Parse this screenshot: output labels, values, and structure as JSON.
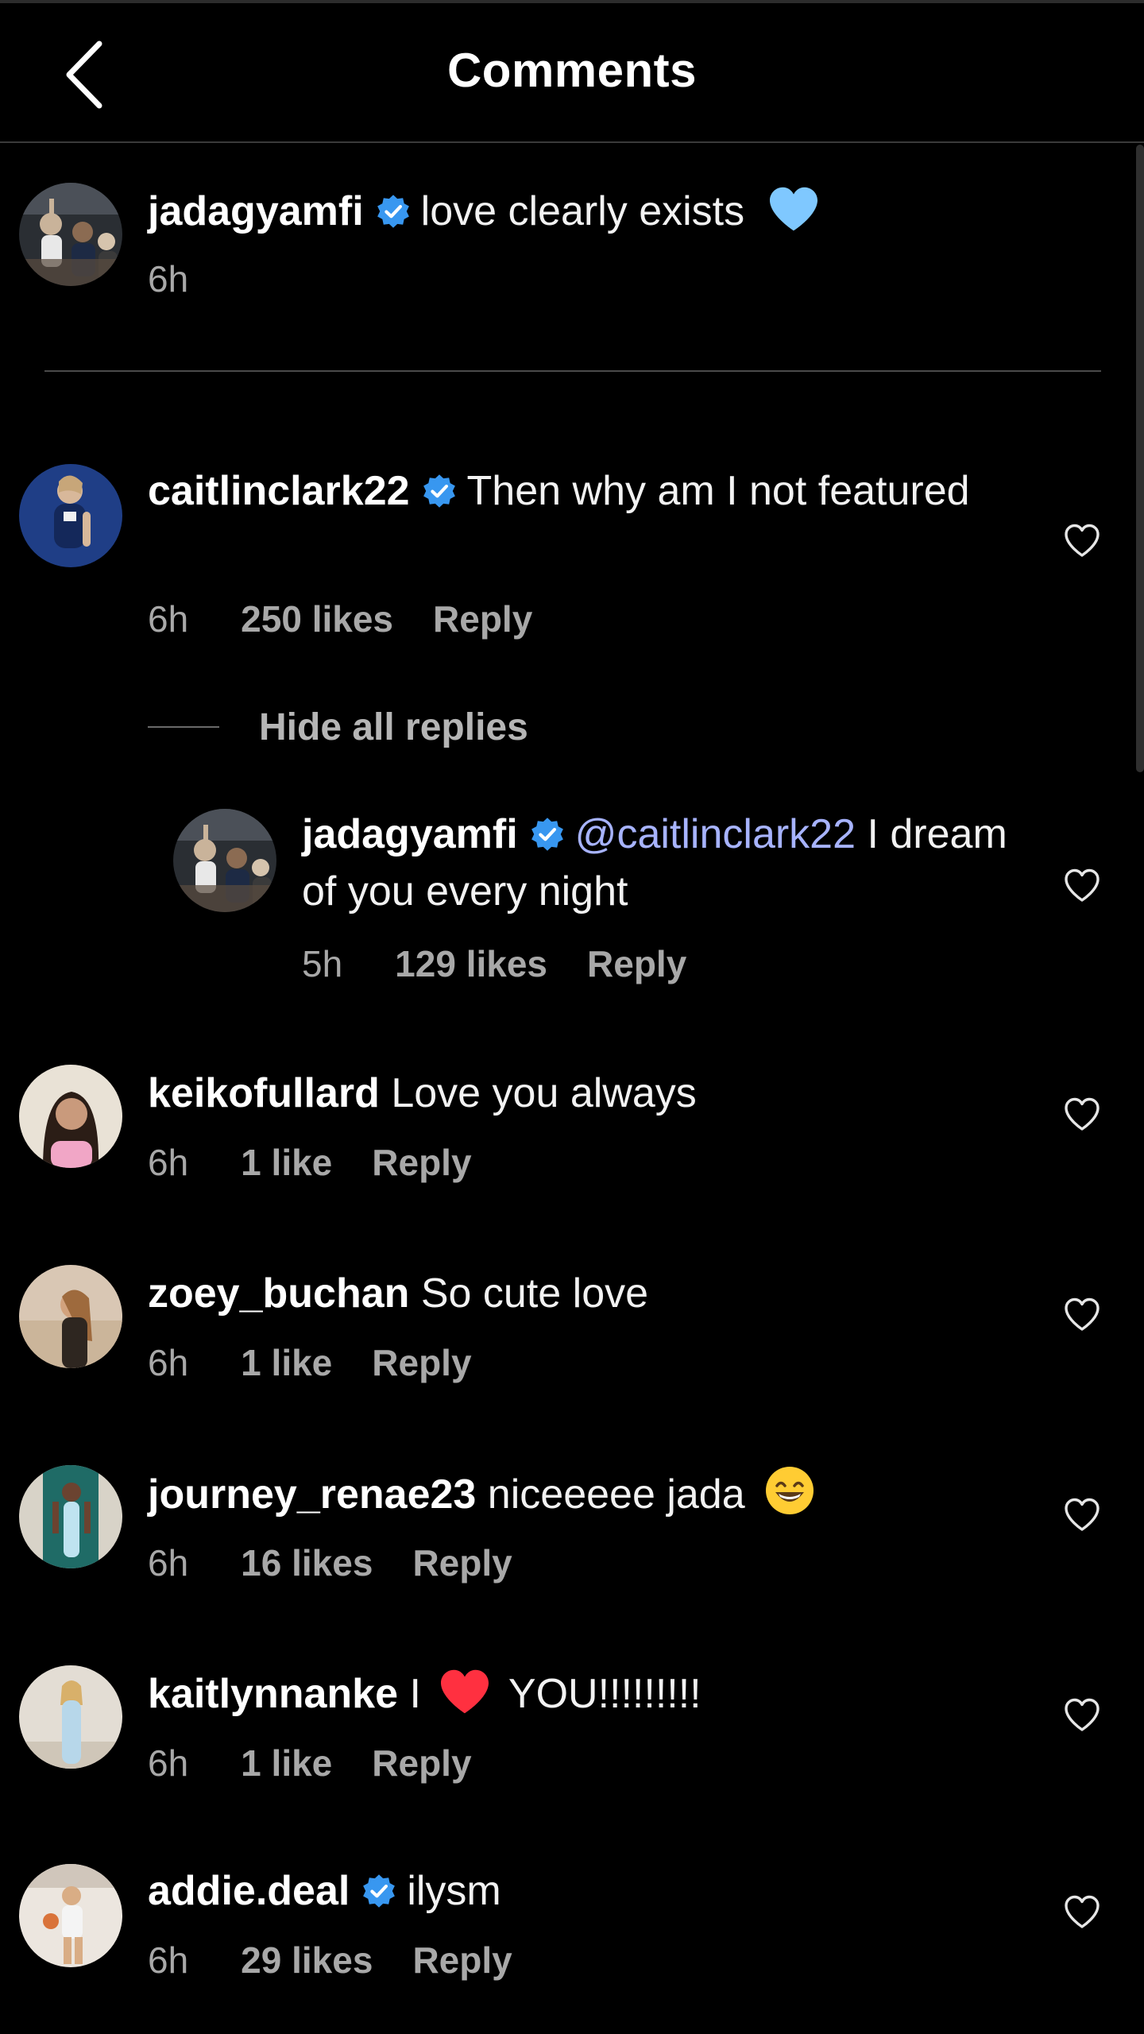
{
  "header": {
    "title": "Comments",
    "back_icon": "chevron-left-icon"
  },
  "colors": {
    "background": "#000000",
    "verified_badge": "#3897f0",
    "mention": "#a7b3ff",
    "meta_text": "#a8a8a8",
    "heart_emoji": "#ff3040",
    "blue_heart_emoji": "#7fc8ff"
  },
  "caption": {
    "username": "jadagyamfi",
    "verified": true,
    "text": "love clearly exists",
    "emoji": "blue-heart-emoji",
    "time": "6h"
  },
  "comments": [
    {
      "username": "caitlinclark22",
      "verified": true,
      "text": "Then why am I not featured",
      "time": "6h",
      "likes": "250 likes",
      "reply_label": "Reply"
    },
    {
      "username": "jadagyamfi",
      "verified": true,
      "mention": "@caitlinclark22",
      "text": "I dream of you every night",
      "time": "5h",
      "likes": "129 likes",
      "reply_label": "Reply",
      "is_reply": true
    },
    {
      "username": "keikofullard",
      "verified": false,
      "text": "Love you always",
      "time": "6h",
      "likes": "1 like",
      "reply_label": "Reply"
    },
    {
      "username": "zoey_buchan",
      "verified": false,
      "text": "So cute love",
      "time": "6h",
      "likes": "1 like",
      "reply_label": "Reply"
    },
    {
      "username": "journey_renae23",
      "verified": false,
      "text": "niceeeee jada",
      "emoji": "grinning-face-emoji",
      "time": "6h",
      "likes": "16 likes",
      "reply_label": "Reply"
    },
    {
      "username": "kaitlynnanke",
      "verified": false,
      "text_before": "I",
      "emoji": "red-heart-emoji",
      "text_after": "YOU!!!!!!!!!",
      "time": "6h",
      "likes": "1 like",
      "reply_label": "Reply"
    },
    {
      "username": "addie.deal",
      "verified": true,
      "text": "ilysm",
      "time": "6h",
      "likes": "29 likes",
      "reply_label": "Reply"
    }
  ],
  "thread": {
    "hide_replies_label": "Hide all replies"
  }
}
